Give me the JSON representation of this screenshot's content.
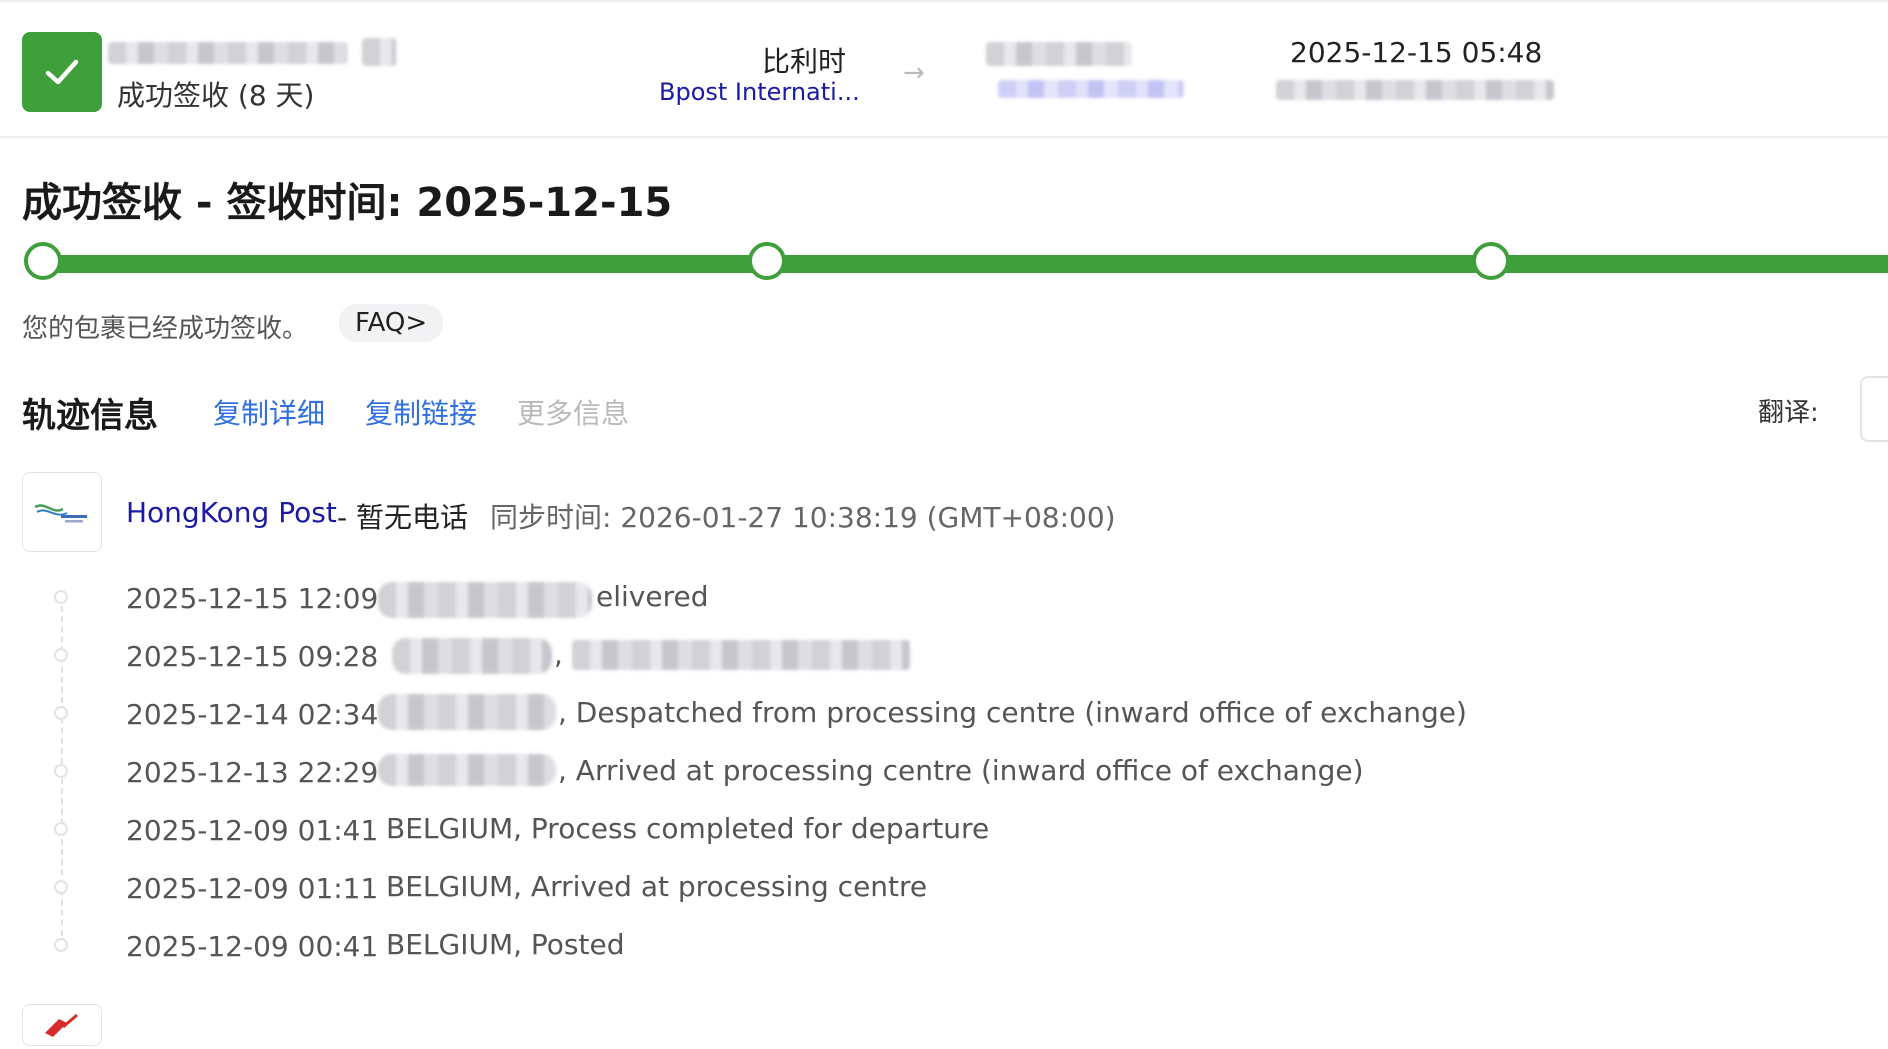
{
  "header": {
    "status_text": "成功签收 (8 天)",
    "origin_country": "比利时",
    "origin_carrier": "Bpost Internati...",
    "arrow": "→",
    "latest_time": "2025-12-15 05:48"
  },
  "summary": {
    "title": "成功签收 - 签收时间: 2025-12-15",
    "progress_percent": 100,
    "message": "您的包裹已经成功签收。",
    "faq_label": "FAQ>"
  },
  "tracking": {
    "section_title": "轨迹信息",
    "actions": {
      "copy_details": "复制详细",
      "copy_link": "复制链接",
      "more_info": "更多信息"
    },
    "translate_label": "翻译:",
    "carrier": {
      "name": "HongKong Post",
      "phone": "- 暂无电话",
      "sync": "同步时间: 2026-01-27 10:38:19 (GMT+08:00)"
    },
    "events": [
      {
        "time": "2025-12-15 12:09",
        "desc": "elivered"
      },
      {
        "time": "2025-12-15 09:28",
        "desc": ","
      },
      {
        "time": "2025-12-14 02:34",
        "desc": ", Despatched from processing centre (inward office of exchange)"
      },
      {
        "time": "2025-12-13 22:29",
        "desc": ", Arrived at processing centre (inward office of exchange)"
      },
      {
        "time": "2025-12-09 01:41",
        "desc": "BELGIUM, Process completed for departure"
      },
      {
        "time": "2025-12-09 01:11",
        "desc": "BELGIUM, Arrived at processing centre"
      },
      {
        "time": "2025-12-09 00:41",
        "desc": "BELGIUM, Posted"
      }
    ]
  },
  "colors": {
    "success_green": "#3f9f3b",
    "link_blue": "#2f6fe0",
    "carrier_blue": "#1a1aa6"
  }
}
